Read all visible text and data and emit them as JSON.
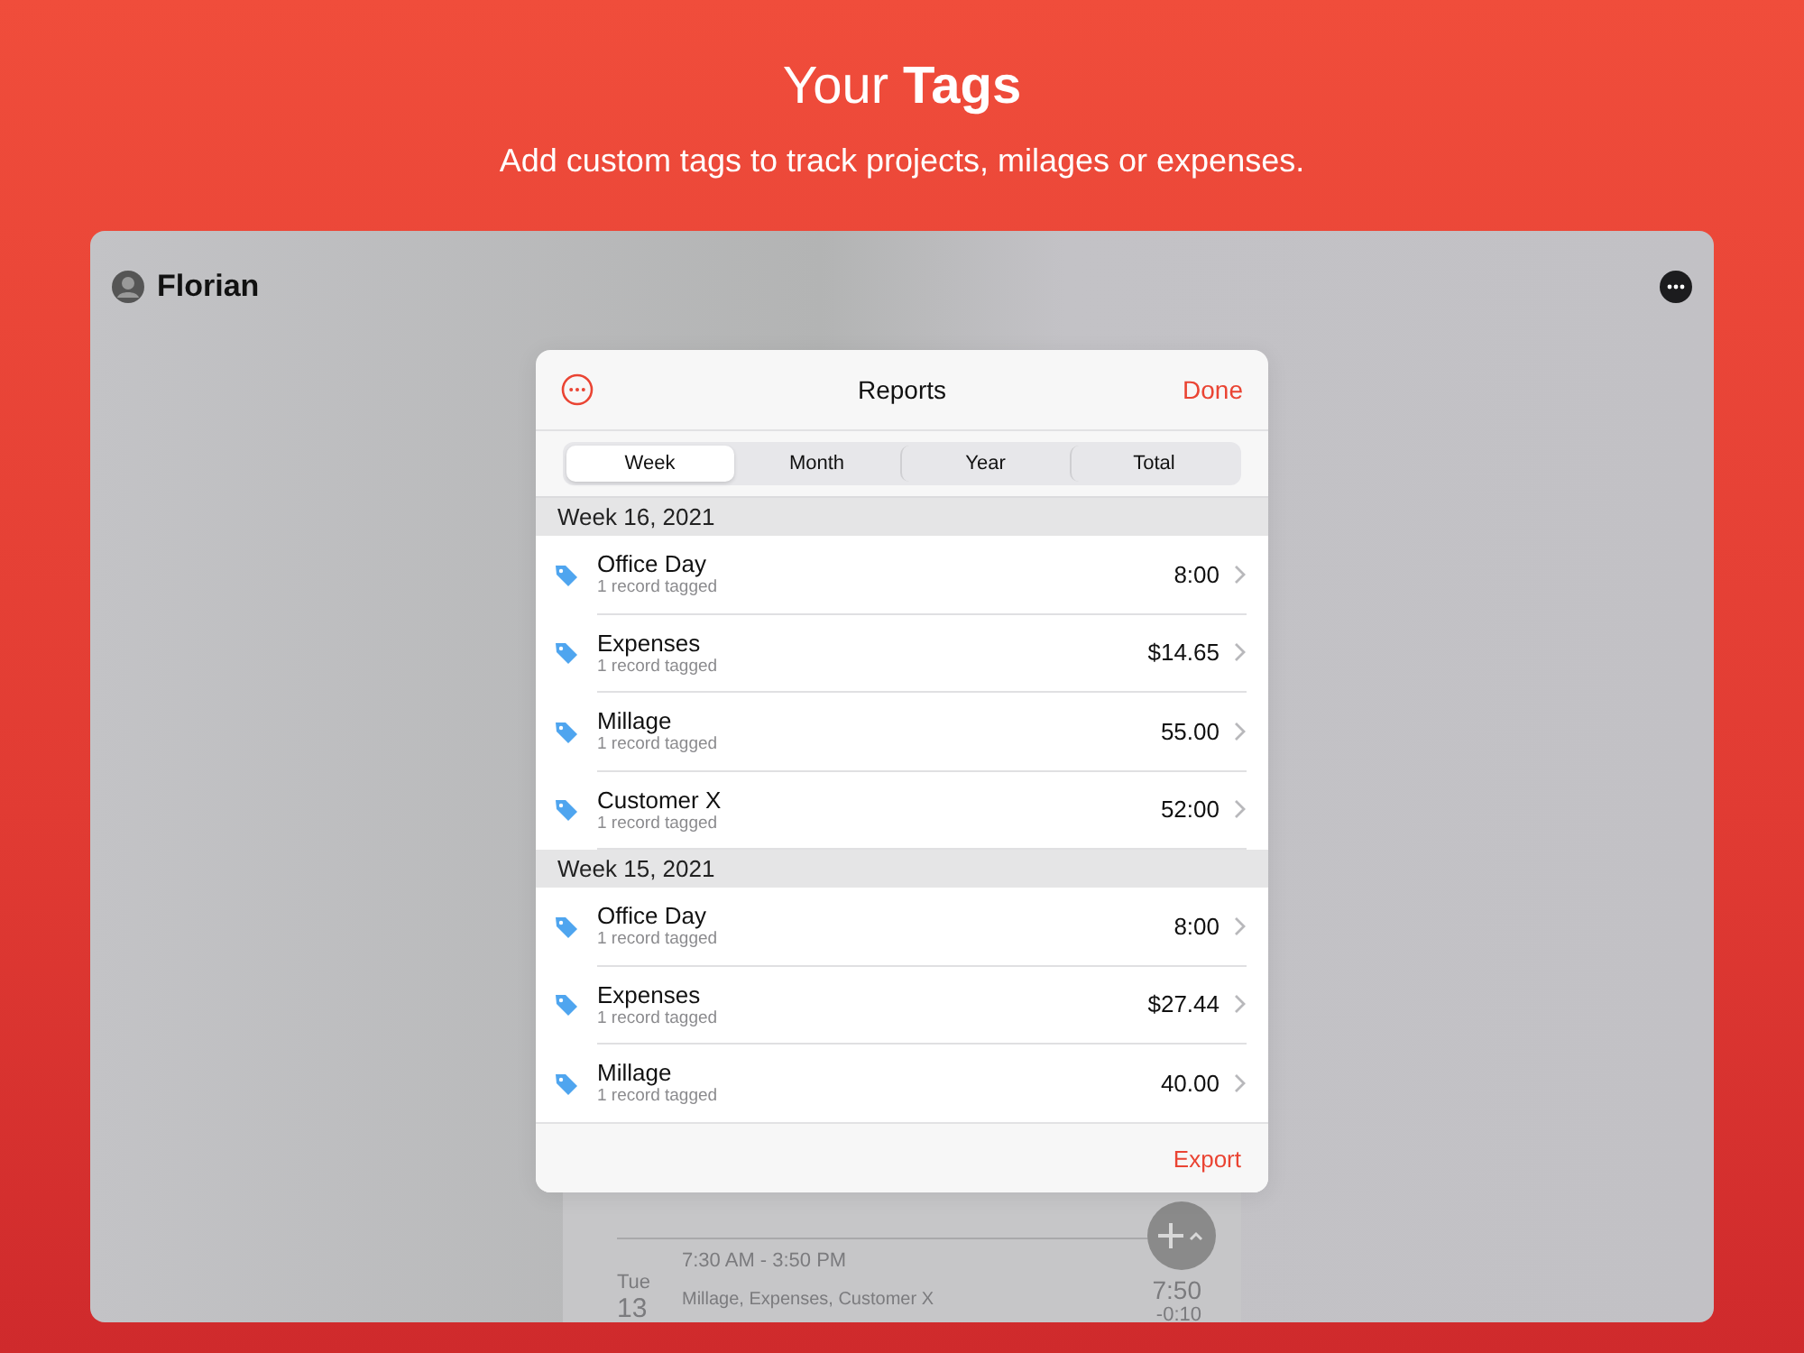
{
  "header": {
    "title": "Your **Tags**",
    "subtitle": "Add custom tags to track projects, milages or expenses."
  },
  "app": {
    "user": "Florian"
  },
  "background_list": {
    "rows": [
      {
        "day_name": "Tue",
        "day": "13",
        "time": "7:30 AM - 3:50 PM",
        "tags": "Millage, Expenses, Customer X",
        "value": "7:50",
        "delta": "-0:10"
      }
    ]
  },
  "modal": {
    "title": "Reports",
    "done": "Done",
    "footer_action": "Export",
    "segments": [
      {
        "label": "Week",
        "selected": true
      },
      {
        "label": "Month",
        "selected": false
      },
      {
        "label": "Year",
        "selected": false
      },
      {
        "label": "Total",
        "selected": false
      }
    ],
    "sections": [
      {
        "title": "Week 16, 2021",
        "rows": [
          {
            "name": "Office Day",
            "subtitle": "1 record tagged",
            "value": "8:00"
          },
          {
            "name": "Expenses",
            "subtitle": "1 record tagged",
            "value": "$14.65"
          },
          {
            "name": "Millage",
            "subtitle": "1 record tagged",
            "value": "55.00"
          },
          {
            "name": "Customer X",
            "subtitle": "1 record tagged",
            "value": "52:00"
          }
        ]
      },
      {
        "title": "Week 15, 2021",
        "rows": [
          {
            "name": "Office Day",
            "subtitle": "1 record tagged",
            "value": "8:00"
          },
          {
            "name": "Expenses",
            "subtitle": "1 record tagged",
            "value": "$27.44"
          },
          {
            "name": "Millage",
            "subtitle": "1 record tagged",
            "value": "40.00"
          }
        ]
      }
    ]
  }
}
